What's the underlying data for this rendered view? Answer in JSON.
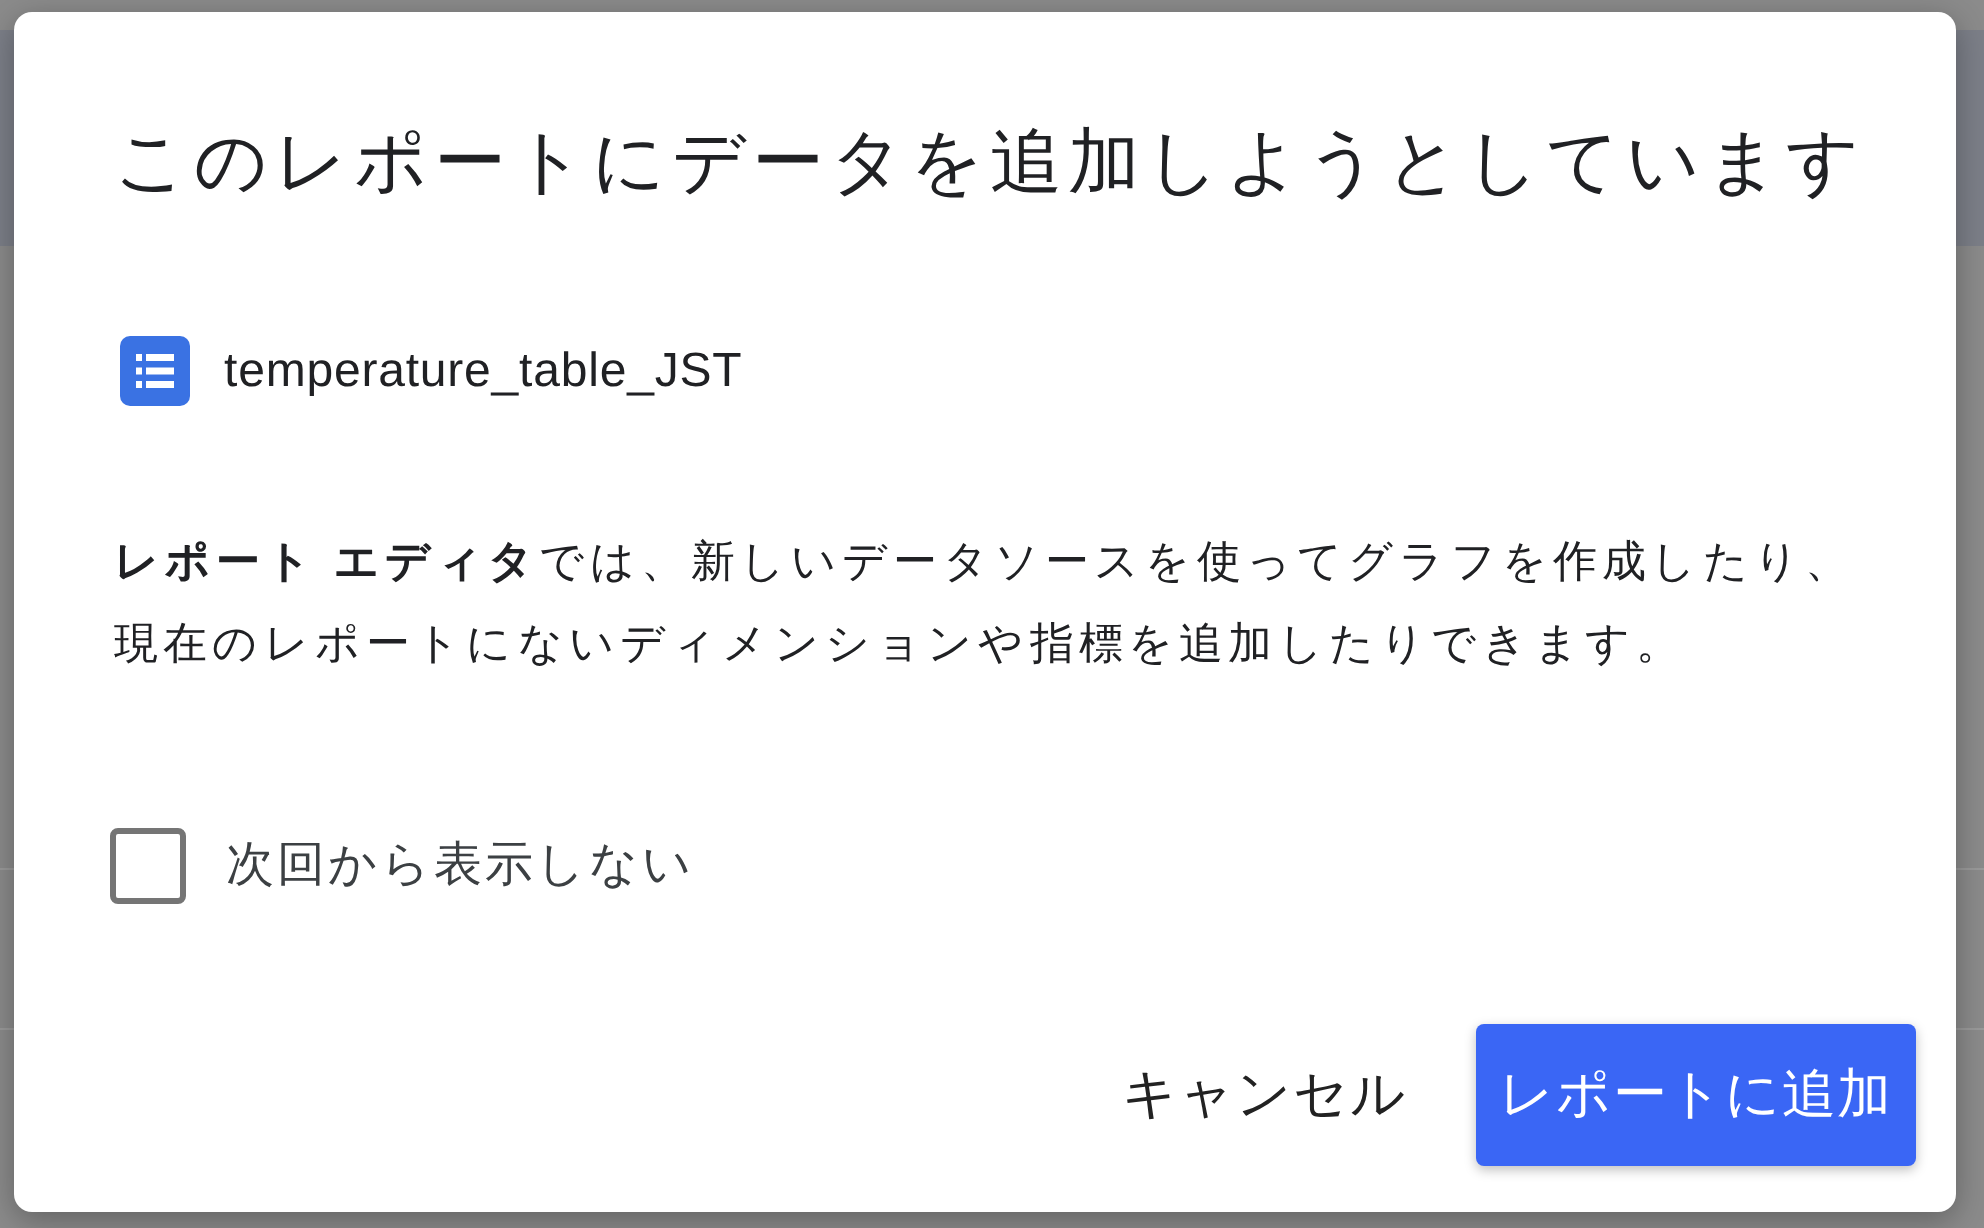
{
  "dialog": {
    "title": "このレポートにデータを追加しようとしています",
    "data_source": {
      "name": "temperature_table_JST"
    },
    "description": "**レポート エディタ**では、新しいデータソースを使ってグラフを作成したり、現在のレポートにないディメンションや指標を追加したりできます。",
    "dont_show_again": {
      "label": "次回から表示しない",
      "checked": false
    },
    "buttons": [
      {
        "label": "キャンセル",
        "kind": "text"
      },
      {
        "label": "レポートに追加",
        "kind": "primary"
      }
    ]
  }
}
